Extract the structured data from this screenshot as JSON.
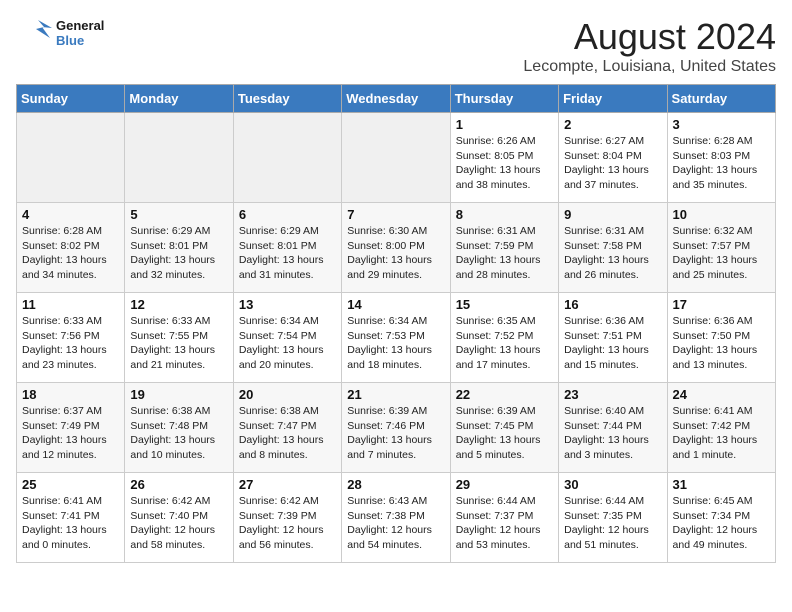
{
  "header": {
    "logo_line1": "General",
    "logo_line2": "Blue",
    "title": "August 2024",
    "subtitle": "Lecompte, Louisiana, United States"
  },
  "days_of_week": [
    "Sunday",
    "Monday",
    "Tuesday",
    "Wednesday",
    "Thursday",
    "Friday",
    "Saturday"
  ],
  "weeks": [
    [
      {
        "day": "",
        "empty": true
      },
      {
        "day": "",
        "empty": true
      },
      {
        "day": "",
        "empty": true
      },
      {
        "day": "",
        "empty": true
      },
      {
        "day": "1",
        "sunrise": "6:26 AM",
        "sunset": "8:05 PM",
        "daylight": "13 hours and 38 minutes."
      },
      {
        "day": "2",
        "sunrise": "6:27 AM",
        "sunset": "8:04 PM",
        "daylight": "13 hours and 37 minutes."
      },
      {
        "day": "3",
        "sunrise": "6:28 AM",
        "sunset": "8:03 PM",
        "daylight": "13 hours and 35 minutes."
      }
    ],
    [
      {
        "day": "4",
        "sunrise": "6:28 AM",
        "sunset": "8:02 PM",
        "daylight": "13 hours and 34 minutes."
      },
      {
        "day": "5",
        "sunrise": "6:29 AM",
        "sunset": "8:01 PM",
        "daylight": "13 hours and 32 minutes."
      },
      {
        "day": "6",
        "sunrise": "6:29 AM",
        "sunset": "8:01 PM",
        "daylight": "13 hours and 31 minutes."
      },
      {
        "day": "7",
        "sunrise": "6:30 AM",
        "sunset": "8:00 PM",
        "daylight": "13 hours and 29 minutes."
      },
      {
        "day": "8",
        "sunrise": "6:31 AM",
        "sunset": "7:59 PM",
        "daylight": "13 hours and 28 minutes."
      },
      {
        "day": "9",
        "sunrise": "6:31 AM",
        "sunset": "7:58 PM",
        "daylight": "13 hours and 26 minutes."
      },
      {
        "day": "10",
        "sunrise": "6:32 AM",
        "sunset": "7:57 PM",
        "daylight": "13 hours and 25 minutes."
      }
    ],
    [
      {
        "day": "11",
        "sunrise": "6:33 AM",
        "sunset": "7:56 PM",
        "daylight": "13 hours and 23 minutes."
      },
      {
        "day": "12",
        "sunrise": "6:33 AM",
        "sunset": "7:55 PM",
        "daylight": "13 hours and 21 minutes."
      },
      {
        "day": "13",
        "sunrise": "6:34 AM",
        "sunset": "7:54 PM",
        "daylight": "13 hours and 20 minutes."
      },
      {
        "day": "14",
        "sunrise": "6:34 AM",
        "sunset": "7:53 PM",
        "daylight": "13 hours and 18 minutes."
      },
      {
        "day": "15",
        "sunrise": "6:35 AM",
        "sunset": "7:52 PM",
        "daylight": "13 hours and 17 minutes."
      },
      {
        "day": "16",
        "sunrise": "6:36 AM",
        "sunset": "7:51 PM",
        "daylight": "13 hours and 15 minutes."
      },
      {
        "day": "17",
        "sunrise": "6:36 AM",
        "sunset": "7:50 PM",
        "daylight": "13 hours and 13 minutes."
      }
    ],
    [
      {
        "day": "18",
        "sunrise": "6:37 AM",
        "sunset": "7:49 PM",
        "daylight": "13 hours and 12 minutes."
      },
      {
        "day": "19",
        "sunrise": "6:38 AM",
        "sunset": "7:48 PM",
        "daylight": "13 hours and 10 minutes."
      },
      {
        "day": "20",
        "sunrise": "6:38 AM",
        "sunset": "7:47 PM",
        "daylight": "13 hours and 8 minutes."
      },
      {
        "day": "21",
        "sunrise": "6:39 AM",
        "sunset": "7:46 PM",
        "daylight": "13 hours and 7 minutes."
      },
      {
        "day": "22",
        "sunrise": "6:39 AM",
        "sunset": "7:45 PM",
        "daylight": "13 hours and 5 minutes."
      },
      {
        "day": "23",
        "sunrise": "6:40 AM",
        "sunset": "7:44 PM",
        "daylight": "13 hours and 3 minutes."
      },
      {
        "day": "24",
        "sunrise": "6:41 AM",
        "sunset": "7:42 PM",
        "daylight": "13 hours and 1 minute."
      }
    ],
    [
      {
        "day": "25",
        "sunrise": "6:41 AM",
        "sunset": "7:41 PM",
        "daylight": "13 hours and 0 minutes."
      },
      {
        "day": "26",
        "sunrise": "6:42 AM",
        "sunset": "7:40 PM",
        "daylight": "12 hours and 58 minutes."
      },
      {
        "day": "27",
        "sunrise": "6:42 AM",
        "sunset": "7:39 PM",
        "daylight": "12 hours and 56 minutes."
      },
      {
        "day": "28",
        "sunrise": "6:43 AM",
        "sunset": "7:38 PM",
        "daylight": "12 hours and 54 minutes."
      },
      {
        "day": "29",
        "sunrise": "6:44 AM",
        "sunset": "7:37 PM",
        "daylight": "12 hours and 53 minutes."
      },
      {
        "day": "30",
        "sunrise": "6:44 AM",
        "sunset": "7:35 PM",
        "daylight": "12 hours and 51 minutes."
      },
      {
        "day": "31",
        "sunrise": "6:45 AM",
        "sunset": "7:34 PM",
        "daylight": "12 hours and 49 minutes."
      }
    ]
  ]
}
